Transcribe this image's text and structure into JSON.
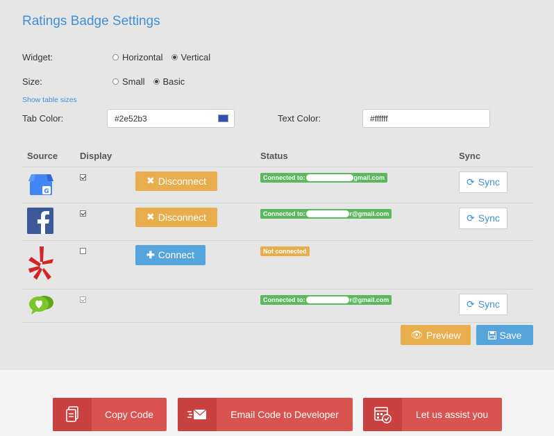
{
  "title": "Ratings Badge Settings",
  "widget": {
    "label": "Widget:",
    "options": [
      "Horizontal",
      "Vertical"
    ],
    "selected": "Vertical"
  },
  "size": {
    "label": "Size:",
    "options": [
      "Small",
      "Basic"
    ],
    "selected": "Basic"
  },
  "show_table_sizes": "Show table sizes",
  "tab_color": {
    "label": "Tab Color:",
    "value": "#2e52b3"
  },
  "text_color": {
    "label": "Text Color:",
    "value": "#ffffff"
  },
  "table": {
    "headers": [
      "Source",
      "Display",
      "Status",
      "Sync"
    ],
    "rows": [
      {
        "source": "google-my-business-icon",
        "display": true,
        "action": "Disconnect",
        "status_prefix": "Connected to:",
        "status_suffix": "gmail.com",
        "sync": "Sync"
      },
      {
        "source": "facebook-icon",
        "display": true,
        "action": "Disconnect",
        "status_prefix": "Connected to:",
        "status_suffix": "r@gmail.com",
        "sync": "Sync"
      },
      {
        "source": "yelp-icon",
        "display": false,
        "action": "Connect",
        "status": "Not connected"
      },
      {
        "source": "chat-heart-icon",
        "display": true,
        "status_prefix": "Connected to:",
        "status_suffix": "r@gmail.com",
        "sync": "Sync"
      }
    ]
  },
  "buttons": {
    "preview": "Preview",
    "save": "Save"
  },
  "bottom": {
    "copy_code": "Copy Code",
    "email_code": "Email Code to Developer",
    "assist": "Let us assist you"
  },
  "colors": {
    "accent": "#3e8fd8",
    "warning": "#e8ad4c",
    "info": "#55a4dc",
    "success": "#5cb85c",
    "danger": "#d9534f"
  }
}
